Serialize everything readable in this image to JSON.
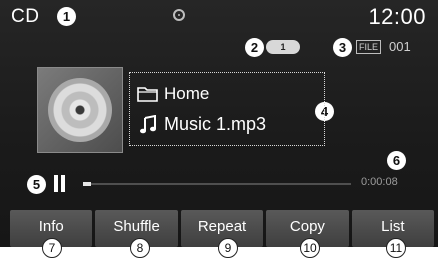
{
  "status_bar": {
    "source": "CD",
    "clock": "12:00"
  },
  "repeat_mode": "1",
  "file": {
    "badge": "FILE",
    "number": "001"
  },
  "track_info": {
    "folder": "Home",
    "track": "Music 1.mp3"
  },
  "playback": {
    "elapsed": "0:00:08",
    "state": "paused"
  },
  "buttons": [
    {
      "label": "Info"
    },
    {
      "label": "Shuffle"
    },
    {
      "label": "Repeat"
    },
    {
      "label": "Copy"
    },
    {
      "label": "List"
    }
  ],
  "callouts": [
    "1",
    "2",
    "3",
    "4",
    "5",
    "6",
    "7",
    "8",
    "9",
    "10",
    "11"
  ]
}
